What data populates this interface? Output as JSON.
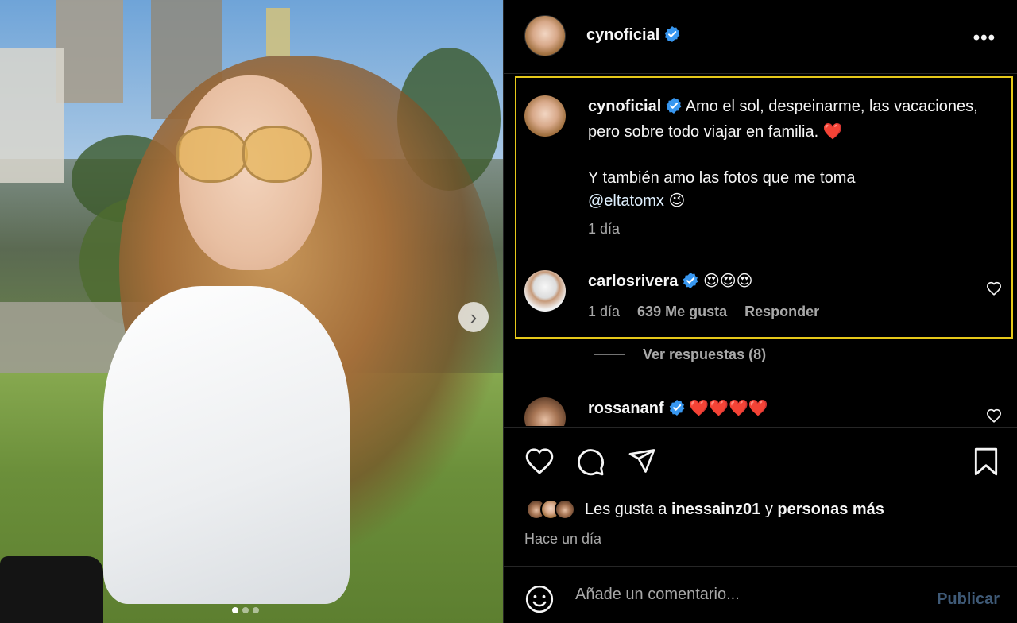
{
  "post": {
    "author": "cynoficial",
    "more_icon": "•••"
  },
  "caption": {
    "username": "cynoficial",
    "text_line1": "Amo el sol, despeinarme, las vacaciones, pero sobre todo viajar en familia. ❤️",
    "text_line2_prefix": "Y también amo las fotos que me toma",
    "mention": "@eltatomx",
    "emoji": "😉",
    "time": "1 día"
  },
  "comments": [
    {
      "username": "carlosrivera",
      "text": "😍😍😍",
      "time": "1 día",
      "likes": "639 Me gusta",
      "reply_label": "Responder"
    },
    {
      "username": "rossananf",
      "text": "❤️❤️❤️❤️"
    }
  ],
  "replies_label": "Ver respuestas (8)",
  "likes": {
    "prefix": "Les gusta a",
    "user": "inessainz01",
    "connector": "y",
    "others": "personas más"
  },
  "posted_time": "Hace un día",
  "add_comment": {
    "placeholder": "Añade un comentario...",
    "publish_label": "Publicar"
  },
  "carousel": {
    "next_glyph": "›",
    "dots": 3,
    "active_dot": 1
  },
  "colors": {
    "verified": "#3897f0",
    "highlight": "#e6c81a",
    "publish": "#3f5a77"
  }
}
